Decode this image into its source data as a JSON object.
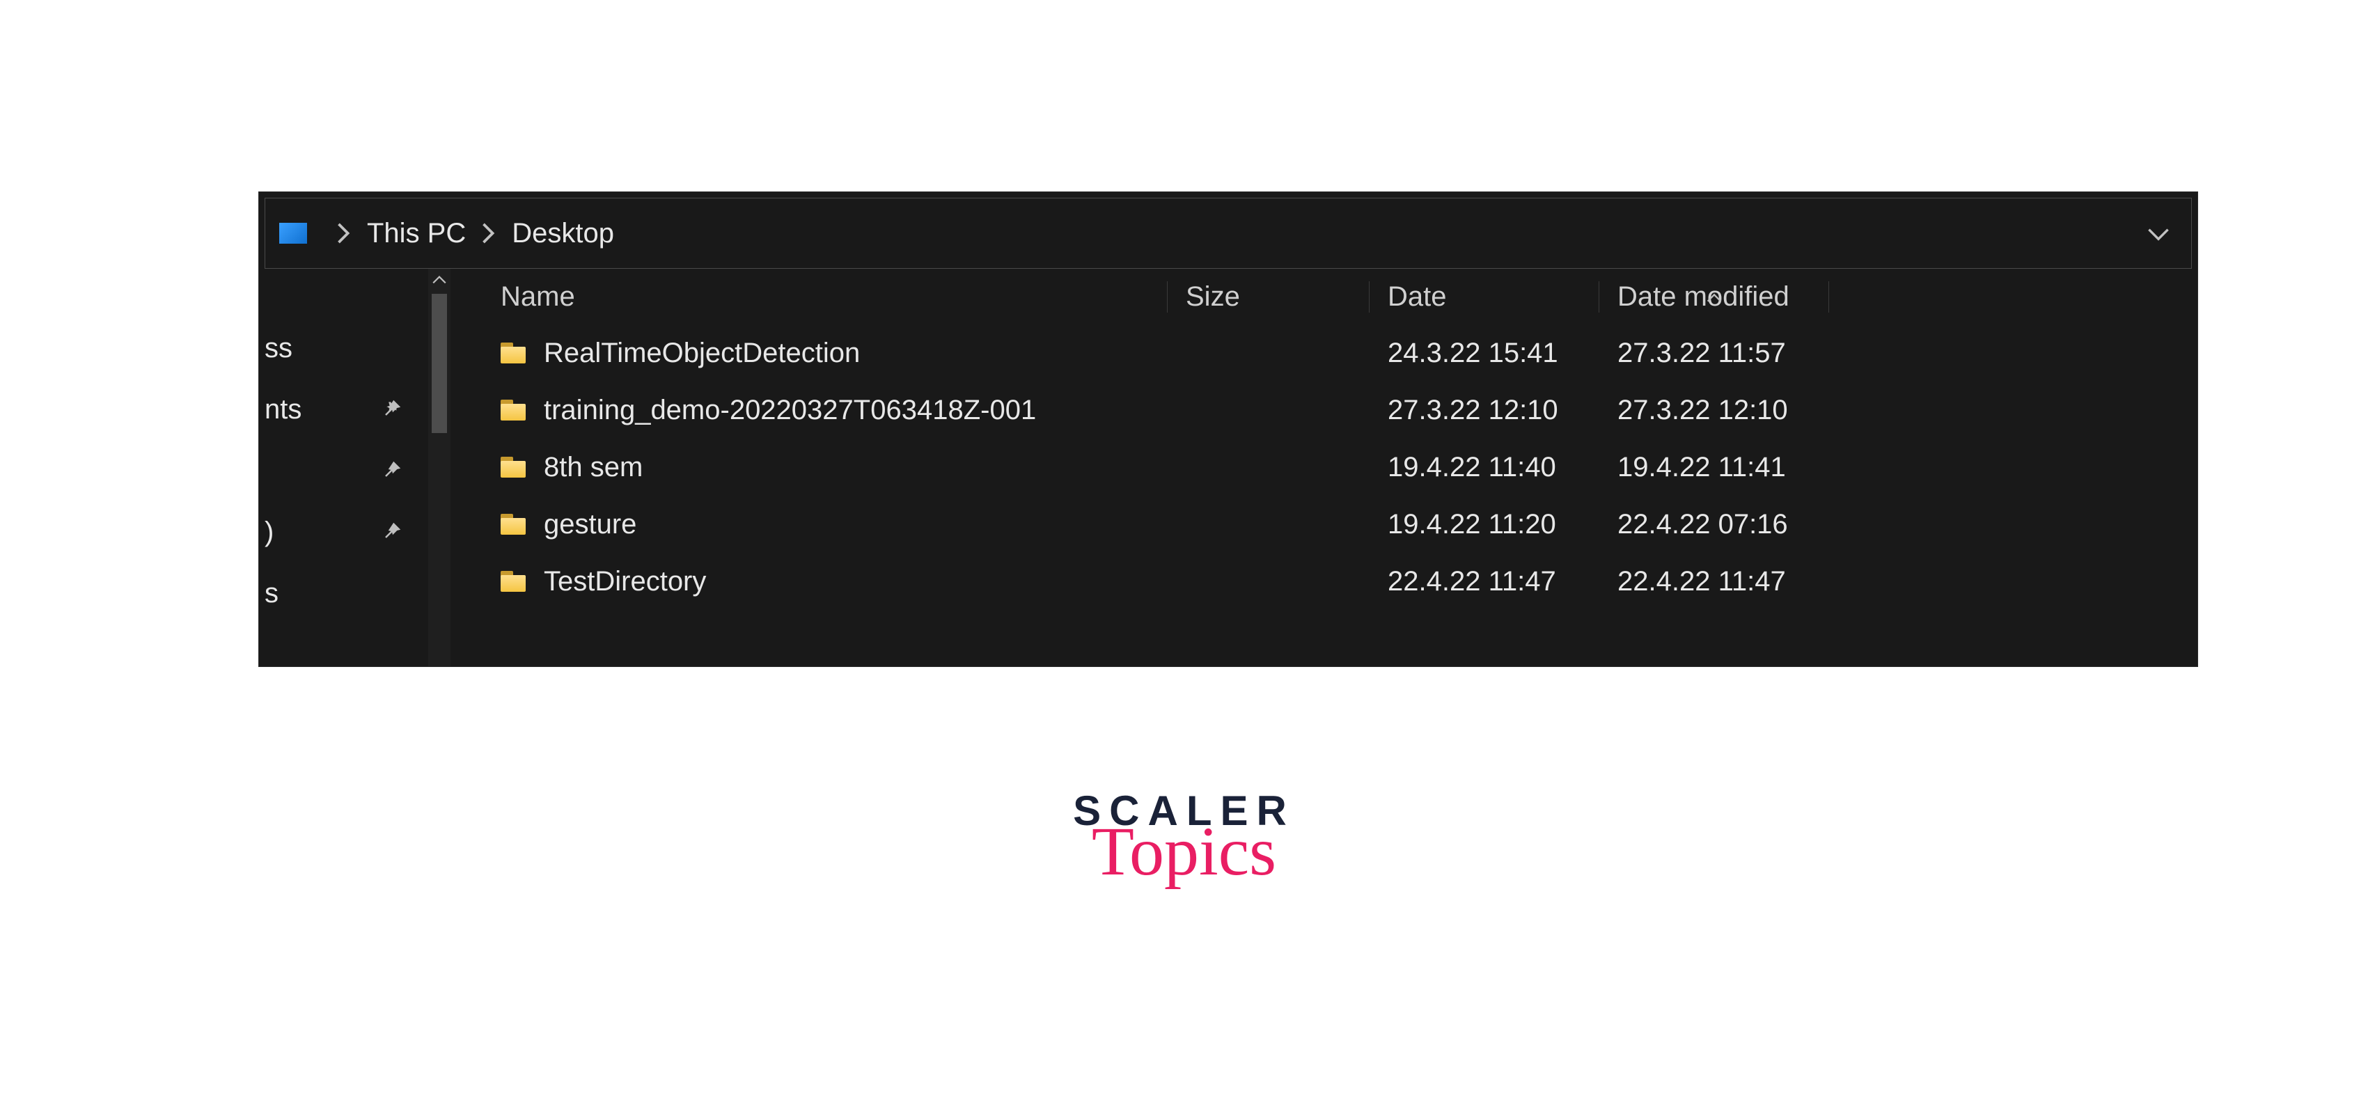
{
  "breadcrumb": {
    "segments": [
      "This PC",
      "Desktop"
    ]
  },
  "sidebar": {
    "items": [
      {
        "label": "ss",
        "pinned": false
      },
      {
        "label": "nts",
        "pinned": true
      },
      {
        "label": "",
        "pinned": true
      },
      {
        "label": ")",
        "pinned": true
      },
      {
        "label": "s",
        "pinned": false
      }
    ]
  },
  "columns": {
    "name": "Name",
    "size": "Size",
    "date": "Date",
    "modified": "Date modified"
  },
  "rows": [
    {
      "name": "RealTimeObjectDetection",
      "size": "",
      "date": "24.3.22 15:41",
      "modified": "27.3.22 11:57"
    },
    {
      "name": "training_demo-20220327T063418Z-001",
      "size": "",
      "date": "27.3.22 12:10",
      "modified": "27.3.22 12:10"
    },
    {
      "name": "8th sem",
      "size": "",
      "date": "19.4.22 11:40",
      "modified": "19.4.22 11:41"
    },
    {
      "name": "gesture",
      "size": "",
      "date": "19.4.22 11:20",
      "modified": "22.4.22 07:16"
    },
    {
      "name": "TestDirectory",
      "size": "",
      "date": "22.4.22 11:47",
      "modified": "22.4.22 11:47"
    }
  ],
  "watermark": {
    "line1": "SCALER",
    "line2": "Topics"
  }
}
